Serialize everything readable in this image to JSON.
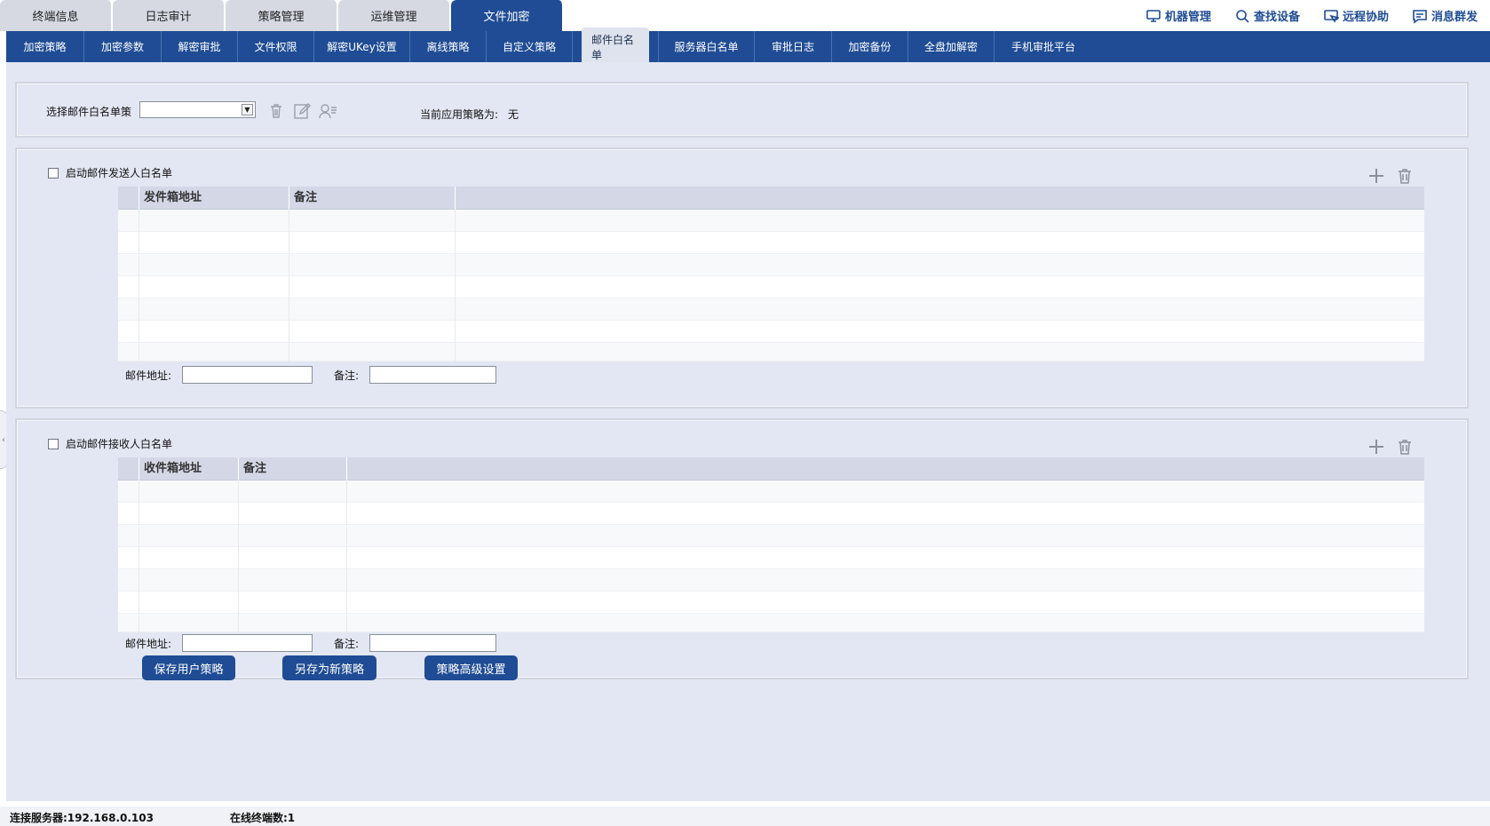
{
  "top_tabs": [
    "终端信息",
    "日志审计",
    "策略管理",
    "运维管理",
    "文件加密"
  ],
  "top_right": [
    {
      "label": "机器管理",
      "icon": "monitor-icon"
    },
    {
      "label": "查找设备",
      "icon": "search-icon"
    },
    {
      "label": "远程协助",
      "icon": "remote-icon"
    },
    {
      "label": "消息群发",
      "icon": "message-icon"
    }
  ],
  "sub_tabs": [
    "加密策略",
    "加密参数",
    "解密审批",
    "文件权限",
    "解密UKey设置",
    "离线策略",
    "自定义策略",
    "邮件白名单",
    "服务器白名单",
    "审批日志",
    "加密备份",
    "全盘加解密",
    "手机审批平台"
  ],
  "policy": {
    "select_label": "选择邮件白名单策",
    "select_value": "",
    "current_label": "当前应用策略为:",
    "current_value": "无"
  },
  "sender": {
    "enable_label": "启动邮件发送人白名单",
    "columns": [
      "发件箱地址",
      "备注"
    ],
    "email_label": "邮件地址:",
    "note_label": "备注:"
  },
  "receiver": {
    "enable_label": "启动邮件接收人白名单",
    "columns": [
      "收件箱地址",
      "备注"
    ],
    "email_label": "邮件地址:",
    "note_label": "备注:"
  },
  "buttons": {
    "save": "保存用户策略",
    "save_as": "另存为新策略",
    "advanced": "策略高级设置"
  },
  "status": {
    "server": "连接服务器:192.168.0.103",
    "online": "在线终端数:1"
  },
  "colors": {
    "accent": "#1f4c94",
    "background": "#e3e7f3"
  }
}
